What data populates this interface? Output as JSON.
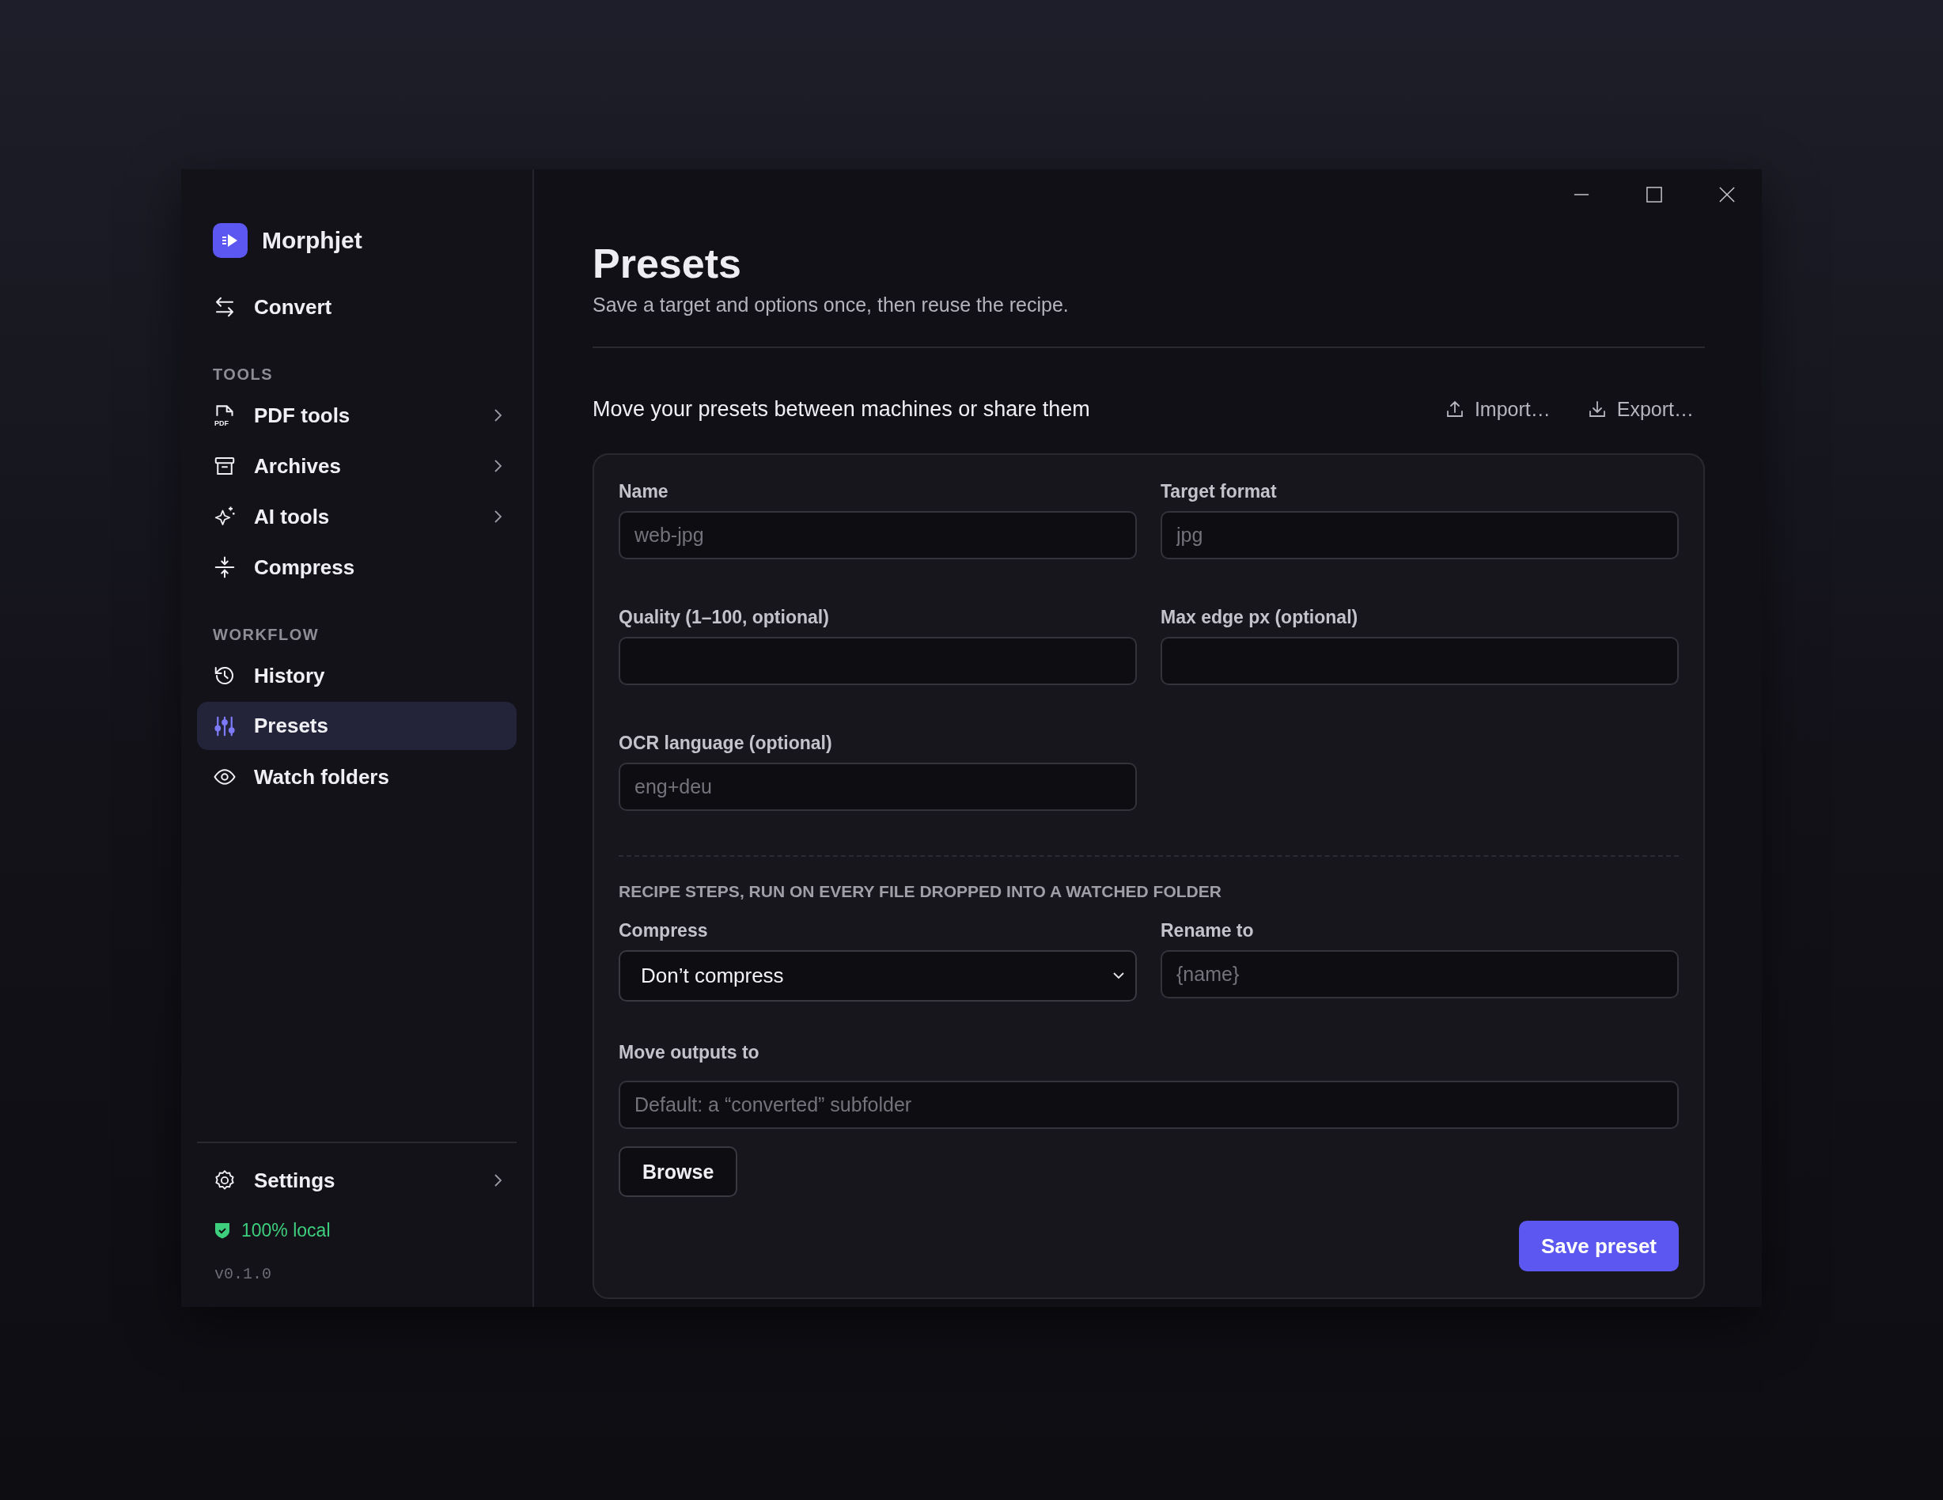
{
  "app": {
    "name": "Morphjet"
  },
  "nav": {
    "top": [
      {
        "label": "Convert",
        "selected": false,
        "expandable": false
      }
    ],
    "sections": [
      {
        "heading": "TOOLS",
        "items": [
          {
            "label": "PDF tools",
            "selected": false,
            "expandable": true,
            "icon_text": "PDF"
          },
          {
            "label": "Archives",
            "selected": false,
            "expandable": true
          },
          {
            "label": "AI tools",
            "selected": false,
            "expandable": true
          },
          {
            "label": "Compress",
            "selected": false,
            "expandable": false
          }
        ]
      },
      {
        "heading": "WORKFLOW",
        "items": [
          {
            "label": "History",
            "selected": false,
            "expandable": false
          },
          {
            "label": "Presets",
            "selected": true,
            "expandable": false
          },
          {
            "label": "Watch folders",
            "selected": false,
            "expandable": false
          }
        ]
      }
    ],
    "footer": {
      "settings": {
        "label": "Settings",
        "expandable": true
      },
      "status": "100% local",
      "version": "v0.1.0"
    }
  },
  "page": {
    "title": "Presets",
    "subtitle": "Save a target and options once, then reuse the recipe."
  },
  "share": {
    "text": "Move your presets between machines or share them",
    "buttons": [
      "Import…",
      "Export…"
    ]
  },
  "form": {
    "fields": [
      {
        "label": "Name",
        "kind": "text",
        "placeholder": "web-jpg"
      },
      {
        "label": "Target format",
        "kind": "text",
        "placeholder": "jpg"
      },
      {
        "label": "Quality (1–100, optional)",
        "kind": "text"
      },
      {
        "label": "Max edge px (optional)",
        "kind": "text"
      },
      {
        "label": "OCR language (optional)",
        "kind": "text",
        "placeholder": "eng+deu"
      }
    ],
    "recipe_heading": "RECIPE STEPS, RUN ON EVERY FILE DROPPED INTO A WATCHED FOLDER",
    "recipe_fields": [
      {
        "label": "Compress",
        "kind": "select",
        "value": "Don’t compress"
      },
      {
        "label": "Rename to",
        "kind": "text",
        "placeholder": "{name}"
      },
      {
        "label": "Move outputs to",
        "kind": "text",
        "wide": true,
        "placeholder": "Default: a “converted” subfolder"
      }
    ],
    "browse": "Browse",
    "save": "Save preset"
  }
}
